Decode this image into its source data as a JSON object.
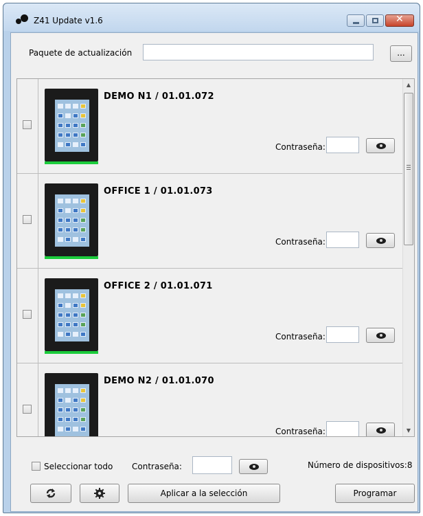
{
  "window": {
    "title": "Z41 Update v1.6",
    "controls": {
      "minimize_icon": "minimize-icon",
      "maximize_icon": "maximize-icon",
      "close_icon": "close-icon",
      "close_glyph": "✕"
    }
  },
  "package": {
    "label": "Paquete de actualización",
    "value": "",
    "browse_label": "..."
  },
  "devices": [
    {
      "name": "DEMO N1 / 01.01.072",
      "checked": false,
      "password_label": "Contraseña:",
      "password_value": ""
    },
    {
      "name": "OFFICE 1 / 01.01.073",
      "checked": false,
      "password_label": "Contraseña:",
      "password_value": ""
    },
    {
      "name": "OFFICE 2 / 01.01.071",
      "checked": false,
      "password_label": "Contraseña:",
      "password_value": ""
    },
    {
      "name": "DEMO N2 / 01.01.070",
      "checked": false,
      "password_label": "Contraseña:",
      "password_value": ""
    }
  ],
  "scrollbar": {
    "up_glyph": "▲",
    "down_glyph": "▼"
  },
  "footer": {
    "select_all_label": "Seleccionar todo",
    "select_all_checked": false,
    "password_label": "Contraseña:",
    "password_value": "",
    "device_count_text": "Número de dispositivos:8",
    "refresh_icon": "refresh-icon",
    "settings_icon": "gear-icon",
    "apply_label": "Aplicar a la selección",
    "program_label": "Programar"
  },
  "colors": {
    "status_bar_green": "#1ccc3c",
    "title_bar": "#c2d7ee",
    "close_button": "#c7432a"
  }
}
